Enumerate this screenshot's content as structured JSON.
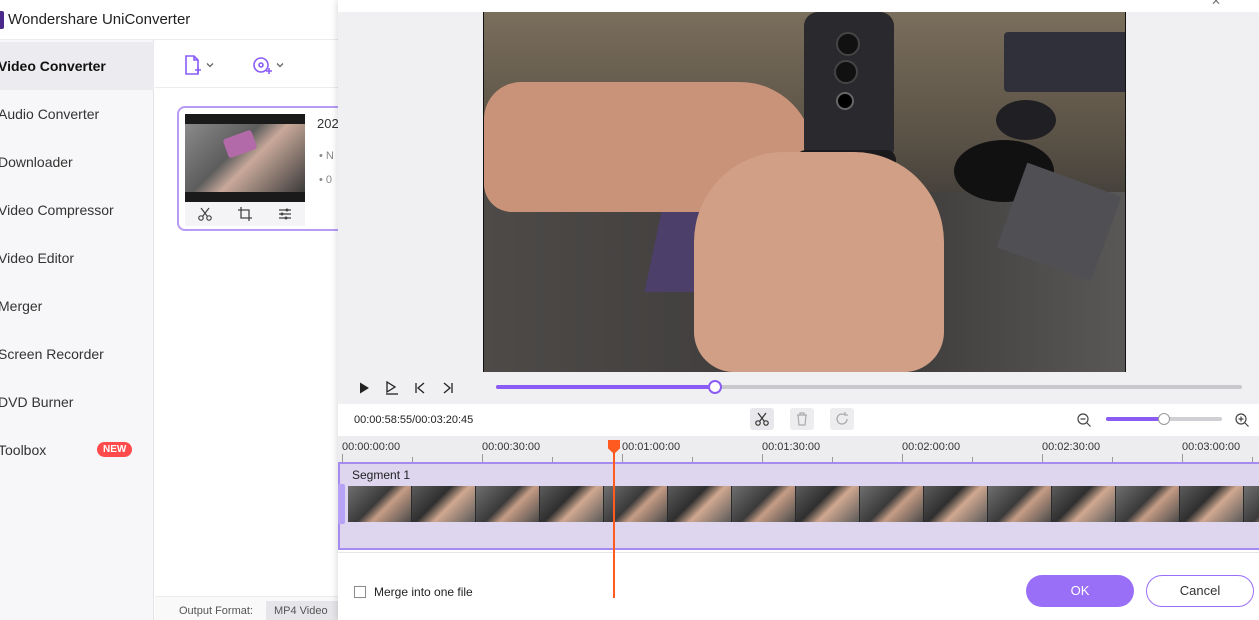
{
  "app": {
    "title": "Wondershare UniConverter"
  },
  "sidebar": {
    "items": [
      {
        "label": "Video Converter",
        "active": true
      },
      {
        "label": "Audio Converter"
      },
      {
        "label": "Downloader"
      },
      {
        "label": "Video Compressor"
      },
      {
        "label": "Video Editor"
      },
      {
        "label": "Merger"
      },
      {
        "label": "Screen Recorder"
      },
      {
        "label": "DVD Burner"
      },
      {
        "label": "Toolbox",
        "badge": "NEW"
      }
    ]
  },
  "file_card": {
    "title": "202",
    "meta1": "N",
    "meta2": "0"
  },
  "output": {
    "label": "Output Format:",
    "value": "MP4 Video"
  },
  "player": {
    "progress_fraction": 0.294,
    "time_readout": "00:00:58:55/00:03:20:45"
  },
  "zoom": {
    "level_fraction": 0.5
  },
  "timeline": {
    "ticks": [
      "00:00:00:00",
      "00:00:30:00",
      "00:01:00:00",
      "00:01:30:00",
      "00:02:00:00",
      "00:02:30:00",
      "00:03:00:00"
    ],
    "segment_label": "Segment 1"
  },
  "footer": {
    "merge_label": "Merge into one file",
    "ok_label": "OK",
    "cancel_label": "Cancel"
  },
  "colors": {
    "accent": "#8a5cf5",
    "playhead": "#ff5a1f",
    "badge": "#ff4b4b"
  }
}
